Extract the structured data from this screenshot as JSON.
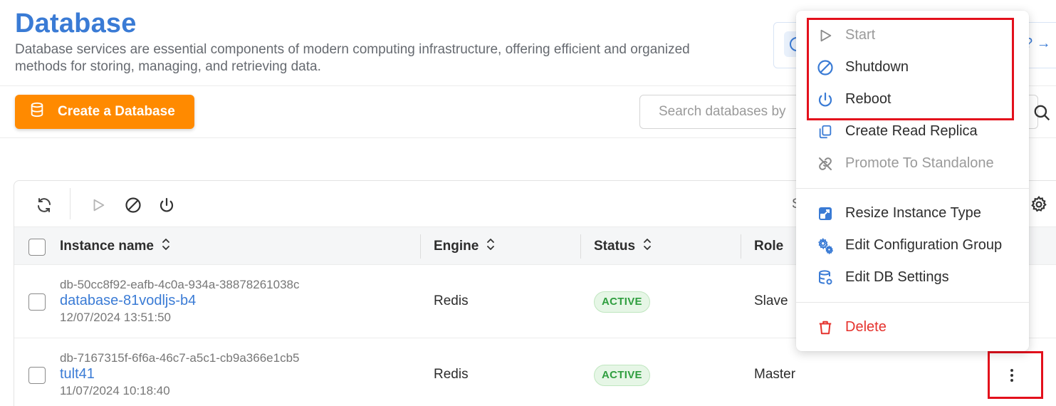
{
  "header": {
    "title": "Database",
    "description": "Database services are essential components of modern computing infrastructure, offering efficient and organized methods for storing, managing, and retrieving data.",
    "info_link": "? →"
  },
  "actions": {
    "create_label": "Create a Database",
    "search_placeholder": "Search databases by"
  },
  "toolbar": {
    "truncated_text": "S"
  },
  "table": {
    "columns": [
      "Instance name",
      "Engine",
      "Status",
      "Role"
    ],
    "rows": [
      {
        "id": "db-50cc8f92-eafb-4c0a-934a-38878261038c",
        "name": "database-81vodljs-b4",
        "date": "12/07/2024 13:51:50",
        "engine": "Redis",
        "status": "ACTIVE",
        "role": "Slave"
      },
      {
        "id": "db-7167315f-6f6a-46c7-a5c1-cb9a366e1cb5",
        "name": "tult41",
        "date": "11/07/2024 10:18:40",
        "engine": "Redis",
        "status": "ACTIVE",
        "role": "Master"
      }
    ]
  },
  "menu": {
    "items": [
      {
        "label": "Start",
        "icon": "play-icon",
        "disabled": true
      },
      {
        "label": "Shutdown",
        "icon": "ban-icon",
        "disabled": false
      },
      {
        "label": "Reboot",
        "icon": "power-icon",
        "disabled": false
      },
      {
        "label": "Create Read Replica",
        "icon": "copy-icon",
        "disabled": false
      },
      {
        "label": "Promote To Standalone",
        "icon": "unlink-icon",
        "disabled": true
      },
      {
        "label": "Resize Instance Type",
        "icon": "resize-icon",
        "disabled": false
      },
      {
        "label": "Edit Configuration Group",
        "icon": "gears-icon",
        "disabled": false
      },
      {
        "label": "Edit DB Settings",
        "icon": "database-settings-icon",
        "disabled": false
      },
      {
        "label": "Delete",
        "icon": "trash-icon",
        "disabled": false
      }
    ]
  },
  "colors": {
    "accent": "#3a7bd5",
    "primary_button": "#ff8a00",
    "danger": "#e5322d",
    "active_badge": "#2f9e3f",
    "highlight": "#e3101c"
  }
}
